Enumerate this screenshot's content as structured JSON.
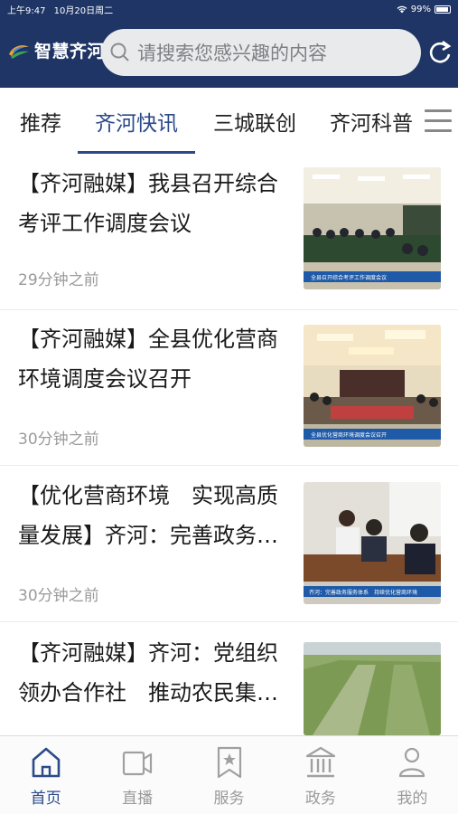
{
  "status_bar": {
    "time": "上午9:47",
    "date": "10月20日周二",
    "battery": "99%"
  },
  "header": {
    "logo_text": "智慧齐河",
    "search_placeholder": "请搜索您感兴趣的内容"
  },
  "tabs": [
    {
      "label": "推荐"
    },
    {
      "label": "齐河快讯",
      "active": true
    },
    {
      "label": "三城联创"
    },
    {
      "label": "齐河科普"
    }
  ],
  "news": [
    {
      "title": "【齐河融媒】我县召开综合考评工作调度会议",
      "time": "29分钟之前",
      "caption": "全县召开综合考评工作调度会议"
    },
    {
      "title": "【齐河融媒】全县优化营商环境调度会议召开",
      "time": "30分钟之前",
      "caption": "全县优化营商环境调度会议召开"
    },
    {
      "title": "【优化营商环境　实现高质量发展】齐河：完善政务…",
      "time": "30分钟之前",
      "caption": "齐河：完善政务服务体系　持续优化营商环境"
    },
    {
      "title": "【齐河融媒】齐河：党组织领办合作社　推动农民集…",
      "time": "",
      "caption": ""
    }
  ],
  "bottom_nav": [
    {
      "label": "首页",
      "icon": "home-icon",
      "active": true
    },
    {
      "label": "直播",
      "icon": "video-icon"
    },
    {
      "label": "服务",
      "icon": "bookmark-star-icon"
    },
    {
      "label": "政务",
      "icon": "government-building-icon"
    },
    {
      "label": "我的",
      "icon": "user-icon"
    }
  ],
  "colors": {
    "header_bg": "#1e3565",
    "accent": "#2b4a8a",
    "inactive": "#9a9a9a"
  }
}
